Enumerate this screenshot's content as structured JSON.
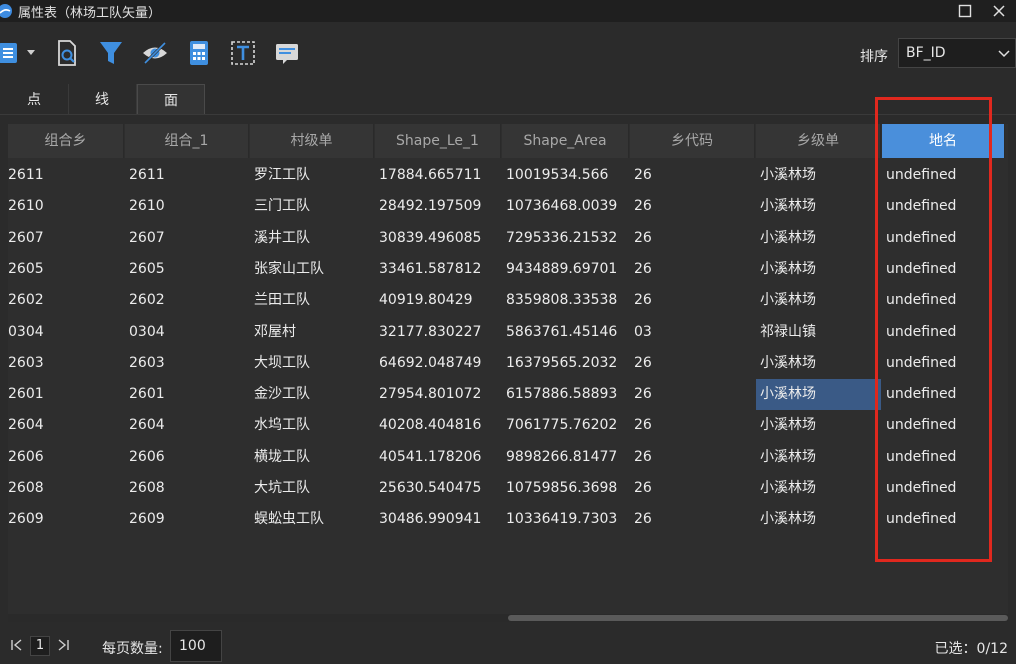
{
  "window": {
    "title": "属性表（林场工队矢量）"
  },
  "toolbar": {
    "icons": [
      "export-csv-icon",
      "query-icon",
      "filter-icon",
      "hide-columns-icon",
      "calculator-icon",
      "field-text-icon",
      "message-icon"
    ],
    "sort_label": "排序",
    "sort_value": "BF_ID"
  },
  "tabs": [
    {
      "label": "点",
      "active": false
    },
    {
      "label": "线",
      "active": false
    },
    {
      "label": "面",
      "active": true
    }
  ],
  "table": {
    "columns": [
      "组合乡",
      "组合_1",
      "村级单",
      "Shape_Le_1",
      "Shape_Area",
      "乡代码",
      "乡级单",
      "地名"
    ],
    "active_column": "地名",
    "rows": [
      [
        "2611",
        "2611",
        "罗江工队",
        "17884.665711",
        "10019534.566",
        "26",
        "小溪林场",
        "undefined"
      ],
      [
        "2610",
        "2610",
        "三门工队",
        "28492.197509",
        "10736468.0039",
        "26",
        "小溪林场",
        "undefined"
      ],
      [
        "2607",
        "2607",
        "溪井工队",
        "30839.496085",
        "7295336.21532",
        "26",
        "小溪林场",
        "undefined"
      ],
      [
        "2605",
        "2605",
        "张家山工队",
        "33461.587812",
        "9434889.69701",
        "26",
        "小溪林场",
        "undefined"
      ],
      [
        "2602",
        "2602",
        "兰田工队",
        "40919.80429",
        "8359808.33538",
        "26",
        "小溪林场",
        "undefined"
      ],
      [
        "0304",
        "0304",
        "邓屋村",
        "32177.830227",
        "5863761.45146",
        "03",
        "祁禄山镇",
        "undefined"
      ],
      [
        "2603",
        "2603",
        "大坝工队",
        "64692.048749",
        "16379565.2032",
        "26",
        "小溪林场",
        "undefined"
      ],
      [
        "2601",
        "2601",
        "金沙工队",
        "27954.801072",
        "6157886.58893",
        "26",
        "小溪林场",
        "undefined"
      ],
      [
        "2604",
        "2604",
        "水坞工队",
        "40208.404816",
        "7061775.76202",
        "26",
        "小溪林场",
        "undefined"
      ],
      [
        "2606",
        "2606",
        "横垅工队",
        "40541.178206",
        "9898266.81477",
        "26",
        "小溪林场",
        "undefined"
      ],
      [
        "2608",
        "2608",
        "大坑工队",
        "25630.540475",
        "10759856.3698",
        "26",
        "小溪林场",
        "undefined"
      ],
      [
        "2609",
        "2609",
        "蜈蚣虫工队",
        "30486.990941",
        "10336419.7303",
        "26",
        "小溪林场",
        "undefined"
      ]
    ],
    "selected_cell": {
      "row": 7,
      "column": 6
    }
  },
  "footer": {
    "page": "1",
    "per_page_label": "每页数量:",
    "per_page_value": "100",
    "selected_text": "已选：0/12"
  },
  "colors": {
    "background": "#2b2b2b",
    "header_active": "#4a8fdb",
    "selected_cell": "#3a5a86",
    "highlight_box": "#e0281e"
  }
}
